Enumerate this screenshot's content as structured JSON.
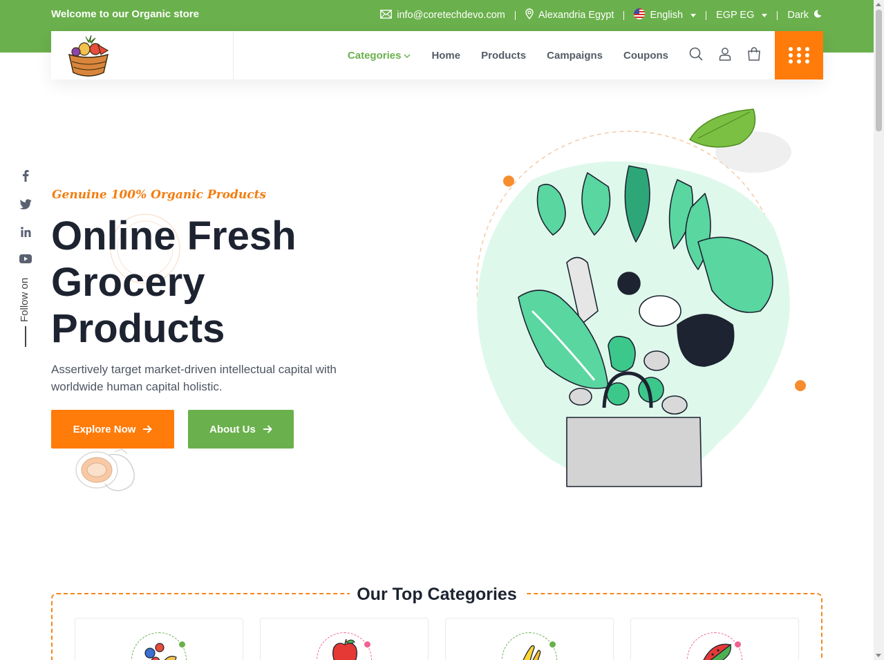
{
  "topbar": {
    "welcome": "Welcome to our Organic store",
    "email": "info@coretechdevo.com",
    "location": "Alexandria Egypt",
    "language": "English",
    "currency": "EGP EG",
    "theme_label": "Dark"
  },
  "nav": {
    "categories": "Categories",
    "home": "Home",
    "products": "Products",
    "campaigns": "Campaigns",
    "coupons": "Coupons"
  },
  "social": {
    "follow_label": "Follow on",
    "icons": [
      "facebook-icon",
      "twitter-icon",
      "linkedin-icon",
      "youtube-icon"
    ]
  },
  "hero": {
    "tagline": "Genuine 100% Organic Products",
    "title_line1": "Online Fresh",
    "title_line2": "Grocery",
    "title_line3": "Products",
    "description": "Assertively target market-driven intellectual capital with worldwide human capital holistic.",
    "explore_button": "Explore Now",
    "about_button": "About Us"
  },
  "categories": {
    "title": "Our Top Categories",
    "items": [
      "berries",
      "apple",
      "banana",
      "watermelon"
    ]
  },
  "colors": {
    "green": "#6ab04c",
    "orange": "#ff7b0a",
    "dark": "#1d2330",
    "mint": "#dff8ec"
  }
}
